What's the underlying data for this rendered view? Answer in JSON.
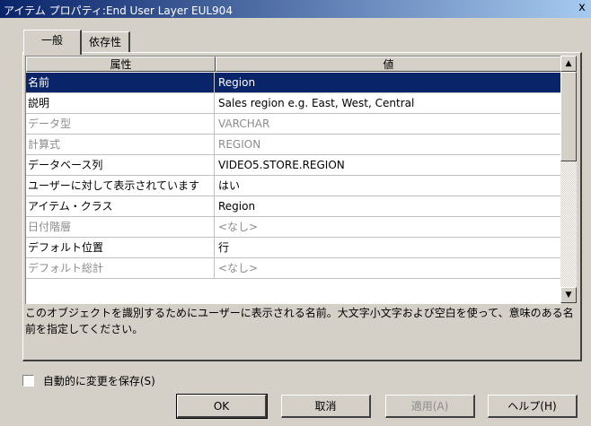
{
  "window": {
    "title": "アイテム プロパティ:End User Layer  EUL904",
    "close_label": "x"
  },
  "tabs": [
    {
      "label": "一般",
      "active": true
    },
    {
      "label": "依存性",
      "active": false
    }
  ],
  "grid": {
    "headers": {
      "property": "属性",
      "value": "値"
    },
    "rows": [
      {
        "property": "名前",
        "value": "Region",
        "state": "selected"
      },
      {
        "property": "説明",
        "value": "Sales region e.g. East, West, Central",
        "state": "normal"
      },
      {
        "property": "データ型",
        "value": "VARCHAR",
        "state": "disabled"
      },
      {
        "property": "計算式",
        "value": "REGION",
        "state": "disabled"
      },
      {
        "property": "データベース列",
        "value": "VIDEO5.STORE.REGION",
        "state": "normal"
      },
      {
        "property": "ユーザーに対して表示されています",
        "value": "はい",
        "state": "normal"
      },
      {
        "property": "アイテム・クラス",
        "value": "Region",
        "state": "normal"
      },
      {
        "property": "日付階層",
        "value": "<なし>",
        "state": "disabled"
      },
      {
        "property": "デフォルト位置",
        "value": "行",
        "state": "normal"
      },
      {
        "property": "デフォルト総計",
        "value": "<なし>",
        "state": "disabled"
      }
    ]
  },
  "description": "このオブジェクトを識別するためにユーザーに表示される名前。大文字小文字および空白を使って、意味のある名前を指定してください。",
  "autosave": {
    "label": "自動的に変更を保存(S)",
    "checked": false
  },
  "buttons": {
    "ok": "OK",
    "cancel": "取消",
    "apply": "適用(A)",
    "help": "ヘルプ(H)"
  }
}
